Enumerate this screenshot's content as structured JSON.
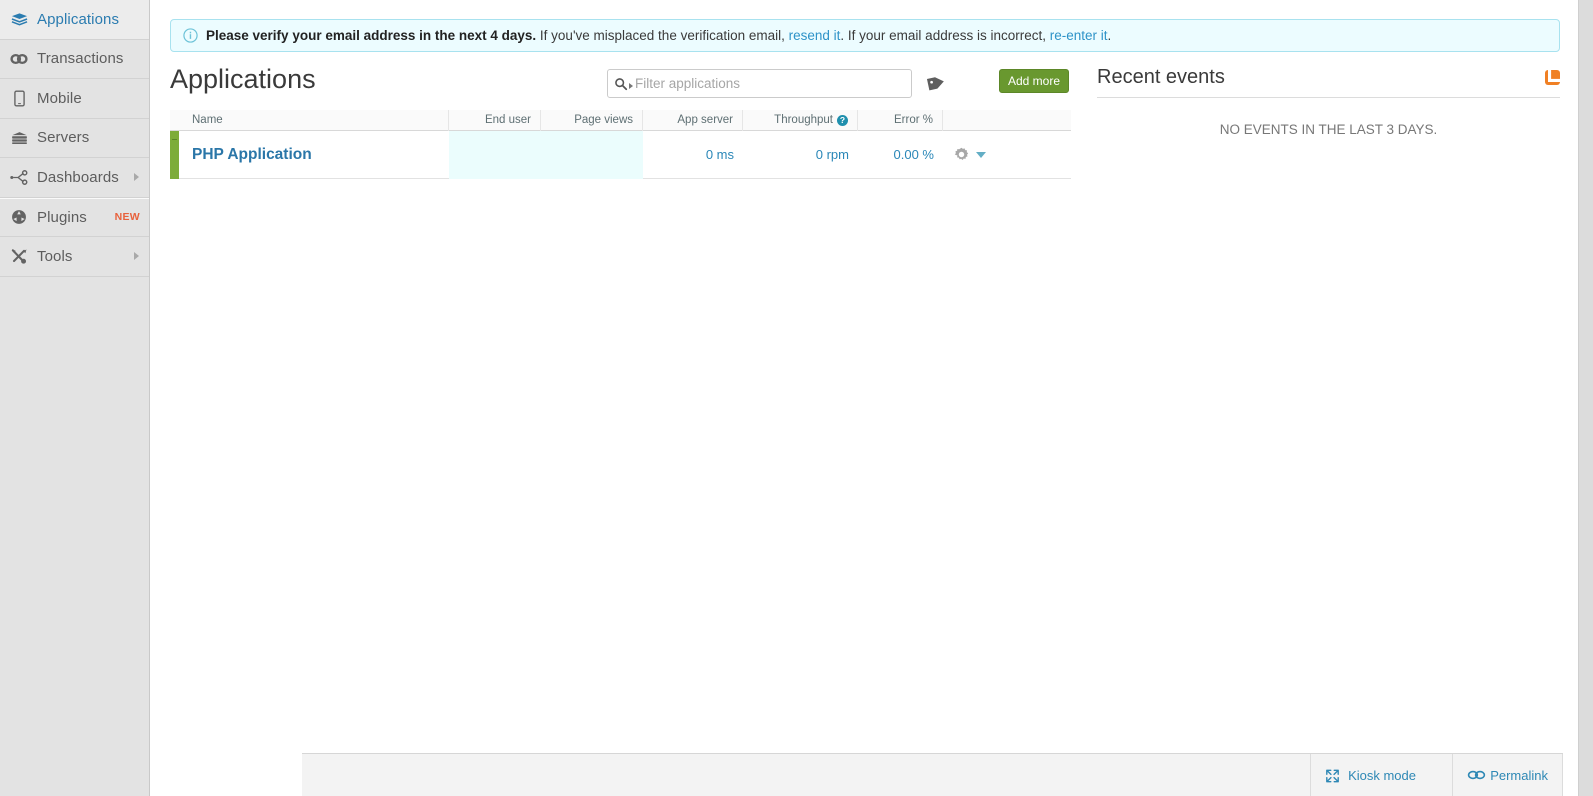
{
  "sidebar": {
    "items": [
      {
        "id": "applications",
        "label": "Applications",
        "icon": "layers-icon",
        "active": true,
        "arrow": false,
        "badge": ""
      },
      {
        "id": "transactions",
        "label": "Transactions",
        "icon": "link-icon",
        "active": false,
        "arrow": false,
        "badge": ""
      },
      {
        "id": "mobile",
        "label": "Mobile",
        "icon": "phone-icon",
        "active": false,
        "arrow": false,
        "badge": ""
      },
      {
        "id": "servers",
        "label": "Servers",
        "icon": "server-icon",
        "active": false,
        "arrow": false,
        "badge": ""
      },
      {
        "id": "dashboards",
        "label": "Dashboards",
        "icon": "share-icon",
        "active": false,
        "arrow": true,
        "badge": ""
      },
      {
        "id": "plugins",
        "label": "Plugins",
        "icon": "plug-icon",
        "active": false,
        "arrow": false,
        "badge": "NEW"
      },
      {
        "id": "tools",
        "label": "Tools",
        "icon": "tools-icon",
        "active": false,
        "arrow": true,
        "badge": ""
      }
    ]
  },
  "notice": {
    "icon": "info-icon",
    "bold_text": "Please verify your email address in the next 4 days.",
    "text_1": " If you've misplaced the verification email, ",
    "link_1": "resend it",
    "text_2": ". If your email address is incorrect, ",
    "link_2": "re-enter it",
    "text_3": "."
  },
  "page": {
    "title": "Applications"
  },
  "filter": {
    "placeholder": "Filter applications",
    "value": "",
    "icon": "search-icon"
  },
  "toolbar": {
    "tag_icon": "tag-icon",
    "add_more_label": "Add more"
  },
  "table": {
    "columns": [
      {
        "key": "name",
        "label": "Name"
      },
      {
        "key": "end_user",
        "label": "End user"
      },
      {
        "key": "page_views",
        "label": "Page views"
      },
      {
        "key": "app_server",
        "label": "App server"
      },
      {
        "key": "throughput",
        "label": "Throughput",
        "help": "?"
      },
      {
        "key": "error_pct",
        "label": "Error %"
      },
      {
        "key": "actions",
        "label": ""
      }
    ],
    "rows": [
      {
        "status_color": "#7dac3a",
        "name": "PHP Application",
        "end_user": "",
        "page_views": "",
        "app_server": "0 ms",
        "throughput": "0 rpm",
        "error_pct": "0.00 %",
        "gear_icon": "gear-icon",
        "caret_icon": "caret-down-icon"
      }
    ]
  },
  "events": {
    "title": "Recent events",
    "rss_icon": "rss-icon",
    "empty_message": "NO EVENTS IN THE LAST 3 DAYS."
  },
  "footer": {
    "kiosk_label": "Kiosk mode",
    "kiosk_icon": "expand-icon",
    "permalink_label": "Permalink",
    "permalink_icon": "link-chain-icon"
  },
  "colors": {
    "accent_blue": "#2a87b8",
    "status_green": "#7dac3a",
    "button_green": "#69982f",
    "notice_bg": "#ecfcff",
    "notice_border": "#a8e2ef",
    "rss_orange": "#f08024",
    "badge_orange": "#e8613c",
    "highlight_cell": "#ebfdfd"
  }
}
